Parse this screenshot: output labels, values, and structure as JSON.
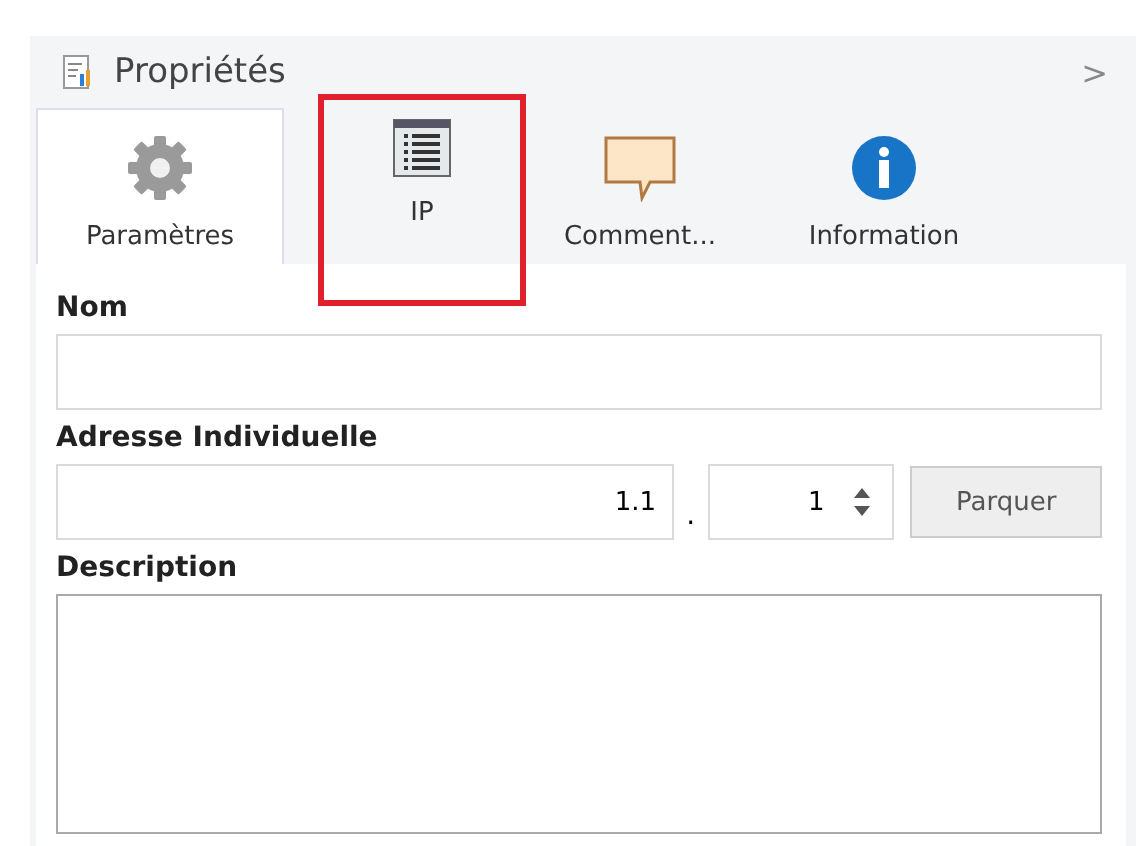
{
  "panel": {
    "title": "Propriétés",
    "collapse_glyph": ">"
  },
  "tabs": [
    {
      "label": "Paramètres",
      "kind": "gear",
      "selected": true,
      "highlighted": false
    },
    {
      "label": "IP",
      "kind": "list",
      "selected": false,
      "highlighted": true
    },
    {
      "label": "Comment...",
      "kind": "comment",
      "selected": false,
      "highlighted": false
    },
    {
      "label": "Information",
      "kind": "info",
      "selected": false,
      "highlighted": false
    }
  ],
  "name_field": {
    "label": "Nom"
  },
  "address": {
    "label": "Adresse Individuelle",
    "area": "1.1",
    "separator": ".",
    "device": "1",
    "button": "Parquer"
  },
  "description": {
    "label": "Description"
  }
}
